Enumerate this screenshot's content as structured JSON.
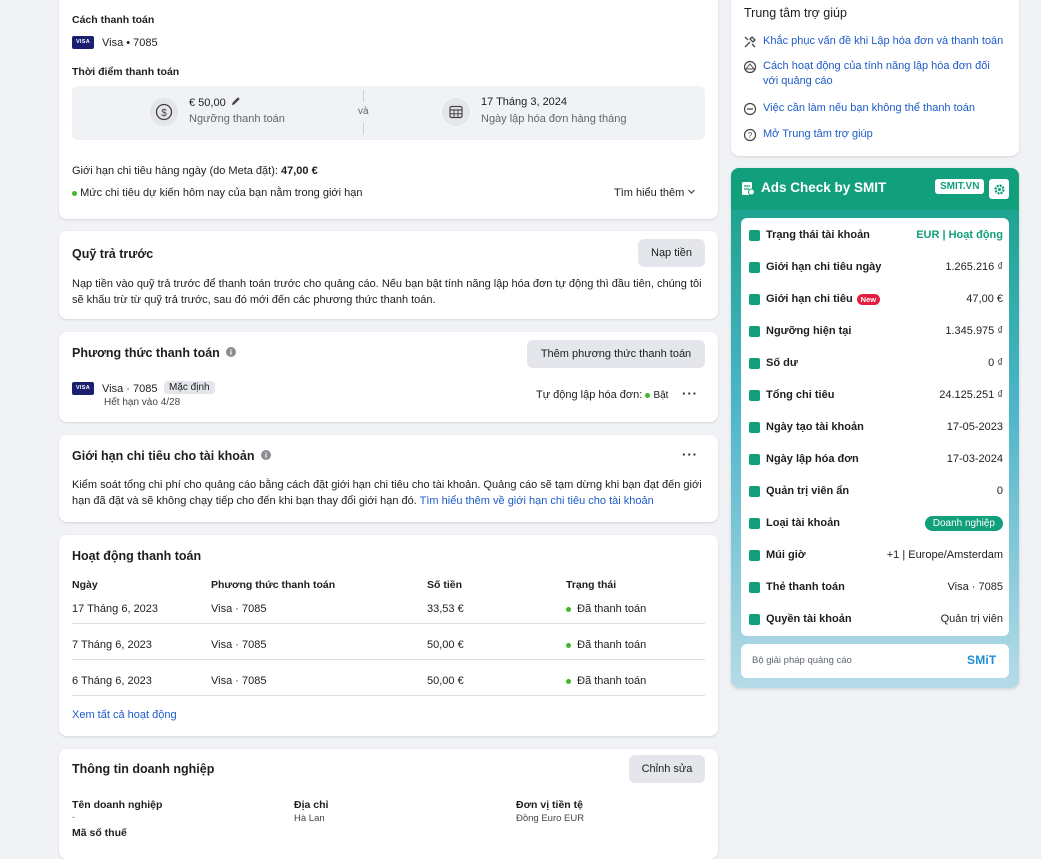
{
  "payment_card": {
    "method_label": "Cách thanh toán",
    "card_text": "Visa • 7085",
    "time_label": "Thời điểm thanh toán",
    "threshold_value": "€ 50,00",
    "threshold_caption": "Ngưỡng thanh toán",
    "and_text": "và",
    "billing_date": "17 Tháng 3, 2024",
    "billing_caption": "Ngày lập hóa đơn hàng tháng",
    "daily_limit_label": "Giới hạn chi tiêu hàng ngày (do Meta đặt):",
    "daily_limit_value": "47,00 €",
    "estimate_text": "Mức chi tiêu dự kiến hôm nay của bạn nằm trong giới hạn",
    "learn_more": "Tìm hiểu thêm"
  },
  "prepaid": {
    "title": "Quỹ trả trước",
    "button": "Nạp tiền",
    "description": "Nạp tiền vào quỹ trả trước để thanh toán trước cho quảng cáo. Nếu bạn bật tính năng lập hóa đơn tự động thì đầu tiên, chúng tôi sẽ khấu trừ từ quỹ trả trước, sau đó mới đến các phương thức thanh toán."
  },
  "payment_methods": {
    "title": "Phương thức thanh toán",
    "button": "Thêm phương thức thanh toán",
    "card_text": "Visa · 7085",
    "default_badge": "Mặc định",
    "expiry": "Hết hạn vào 4/28",
    "auto_billing_label": "Tự động lập hóa đơn:",
    "auto_billing_status": "Bật"
  },
  "spending_limit": {
    "title": "Giới hạn chi tiêu cho tài khoản",
    "description": "Kiểm soát tổng chi phí cho quảng cáo bằng cách đặt giới hạn chi tiêu cho tài khoản. Quảng cáo sẽ tạm dừng khi bạn đạt đến giới hạn đã đặt và sẽ không chạy tiếp cho đến khi bạn thay đổi giới hạn đó.",
    "link": "Tìm hiểu thêm về giới hạn chi tiêu cho tài khoản"
  },
  "activity": {
    "title": "Hoạt động thanh toán",
    "headers": [
      "Ngày",
      "Phương thức thanh toán",
      "Số tiền",
      "Trạng thái"
    ],
    "rows": [
      {
        "date": "17 Tháng 6, 2023",
        "method": "Visa · 7085",
        "amount": "33,53 €",
        "status": "Đã thanh toán"
      },
      {
        "date": "7 Tháng 6, 2023",
        "method": "Visa · 7085",
        "amount": "50,00 €",
        "status": "Đã thanh toán"
      },
      {
        "date": "6 Tháng 6, 2023",
        "method": "Visa · 7085",
        "amount": "50,00 €",
        "status": "Đã thanh toán"
      }
    ],
    "view_all": "Xem tất cả hoạt động"
  },
  "business": {
    "title": "Thông tin doanh nghiệp",
    "button": "Chỉnh sửa",
    "name_label": "Tên doanh nghiệp",
    "name_value": "-",
    "address_label": "Địa chỉ",
    "address_value": "Hà Lan",
    "currency_label": "Đơn vị tiền tệ",
    "currency_value": "Đồng Euro EUR",
    "tax_label": "Mã số thuế"
  },
  "help": {
    "title": "Trung tâm trợ giúp",
    "items": [
      {
        "label": "Khắc phục vấn đề khi Lập hóa đơn và thanh toán",
        "icon": "tools-icon"
      },
      {
        "label": "Cách hoạt động của tính năng lập hóa đơn đối với quảng cáo",
        "icon": "globe-icon"
      },
      {
        "label": "Việc cần làm nếu bạn không thể thanh toán",
        "icon": "minus-circle-icon"
      },
      {
        "label": "Mở Trung tâm trợ giúp",
        "icon": "question-icon"
      }
    ]
  },
  "smit": {
    "title": "Ads Check by SMIT",
    "badge": "SMIT.VN",
    "rows": [
      {
        "label": "Trạng thái tài khoản",
        "value": "EUR | Hoạt động"
      },
      {
        "label": "Giới hạn chi tiêu ngày",
        "value": "1.265.216 ₫"
      },
      {
        "label": "Giới hạn chi tiêu",
        "value": "47,00 €",
        "tag": "New"
      },
      {
        "label": "Ngưỡng hiện tại",
        "value": "1.345.975 ₫"
      },
      {
        "label": "Số dư",
        "value": "0 ₫"
      },
      {
        "label": "Tổng chi tiêu",
        "value": "24.125.251 ₫"
      },
      {
        "label": "Ngày tạo tài khoản",
        "value": "17-05-2023"
      },
      {
        "label": "Ngày lập hóa đơn",
        "value": "17-03-2024"
      },
      {
        "label": "Quản trị viên ẩn",
        "value": "0"
      },
      {
        "label": "Loại tài khoản",
        "value": "Doanh nghiệp"
      },
      {
        "label": "Múi giờ",
        "value": "+1 | Europe/Amsterdam"
      },
      {
        "label": "Thẻ thanh toán",
        "value": "Visa · 7085"
      },
      {
        "label": "Quyền tài khoản",
        "value": "Quản trị viên"
      }
    ],
    "footer": "Bộ giải pháp quảng cáo",
    "footer_logo": "SMiT",
    "accent": "#12a07c"
  }
}
